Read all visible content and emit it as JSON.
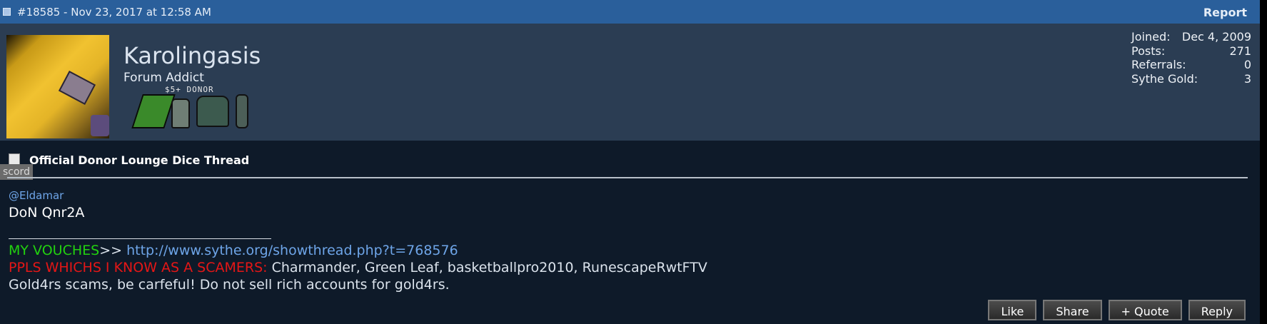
{
  "header": {
    "post_meta": "#18585 - Nov 23, 2017 at 12:58 AM",
    "report_label": "Report"
  },
  "user": {
    "username": "Karolingasis",
    "title": "Forum Addict",
    "donor_label": "$5+ DONOR",
    "stats": [
      {
        "label": "Joined:",
        "value": "Dec 4, 2009"
      },
      {
        "label": "Posts:",
        "value": "271"
      },
      {
        "label": "Referrals:",
        "value": "0"
      },
      {
        "label": "Sythe Gold:",
        "value": "3"
      }
    ]
  },
  "post": {
    "thread_title": "Official Donor Lounge Dice Thread",
    "ghost_label": "scord",
    "mention": "@Eldamar",
    "body": "DoN Qnr2A",
    "signature": {
      "vouches_label": "MY VOUCHES",
      "vouches_arrow": ">> ",
      "vouches_link": "http://www.sythe.org/showthread.php?t=768576",
      "scammers_label": "PPLS WHICHS I KNOW AS A SCAMERS:",
      "scammers_list": " Charmander, Green Leaf, basketballpro2010, RunescapeRwtFTV",
      "warning": "Gold4rs scams, be carfeful! Do not sell rich accounts for gold4rs."
    }
  },
  "actions": {
    "like": "Like",
    "share": "Share",
    "quote": "+ Quote",
    "reply": "Reply"
  }
}
